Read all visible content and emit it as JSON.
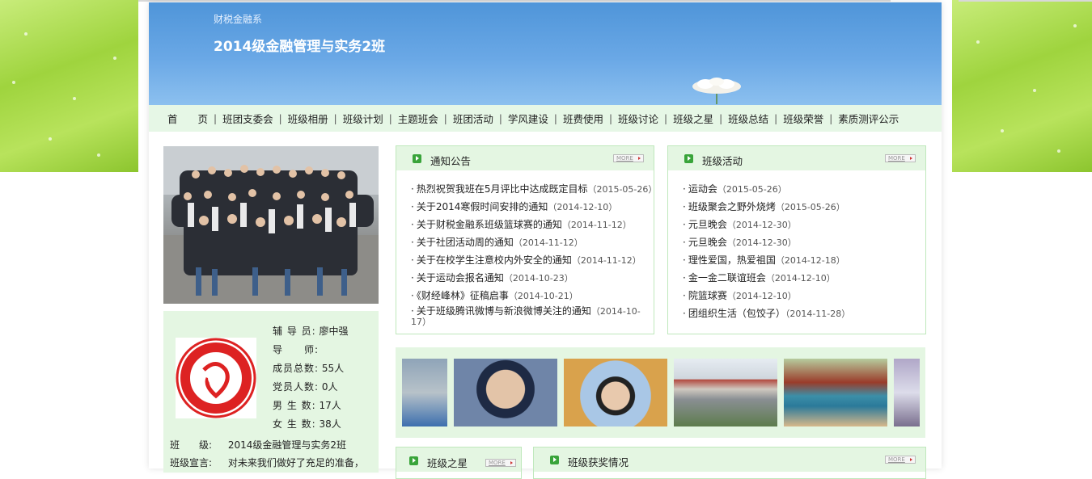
{
  "header": {
    "department": "财税金融系",
    "class_name": "2014级金融管理与实务2班"
  },
  "nav": {
    "items": [
      {
        "label": "首　　页"
      },
      {
        "label": "班团支委会"
      },
      {
        "label": "班级相册"
      },
      {
        "label": "班级计划"
      },
      {
        "label": "主题班会"
      },
      {
        "label": "班团活动"
      },
      {
        "label": "学风建设"
      },
      {
        "label": "班费使用"
      },
      {
        "label": "班级讨论"
      },
      {
        "label": "班级之星"
      },
      {
        "label": "班级总结"
      },
      {
        "label": "班级荣誉"
      },
      {
        "label": "素质测评公示"
      }
    ],
    "separator": "|"
  },
  "profile": {
    "counselor_label": "辅 导 员:",
    "counselor_value": "廖中强",
    "tutor_label": "导　　师:",
    "tutor_value": "",
    "members_label": "成员总数:",
    "members_value": "55人",
    "party_label": "党员人数:",
    "party_value": "0人",
    "male_label": "男 生 数:",
    "male_value": "17人",
    "female_label": "女 生 数:",
    "female_value": "38人",
    "class_label": "班　　级:",
    "class_value": "2014级金融管理与实务2班",
    "motto_label": "班级宣言:",
    "motto_value": "对未来我们做好了充足的准备，"
  },
  "notices": {
    "title": "通知公告",
    "more": "MORE",
    "items": [
      {
        "text": "热烈祝贺我班在5月评比中达成既定目标",
        "date": "（2015-05-26）"
      },
      {
        "text": "关于2014寒假时间安排的通知",
        "date": "（2014-12-10）"
      },
      {
        "text": "关于财税金融系班级篮球赛的通知",
        "date": "（2014-11-12）"
      },
      {
        "text": "关于社团活动周的通知",
        "date": "（2014-11-12）"
      },
      {
        "text": "关于在校学生注意校内外安全的通知",
        "date": "（2014-11-12）"
      },
      {
        "text": "关于运动会报名通知",
        "date": "（2014-10-23）"
      },
      {
        "text": "《财经峰林》征稿启事",
        "date": "（2014-10-21）"
      },
      {
        "text": "关于班级腾讯微博与新浪微博关注的通知",
        "date": "（2014-10-17）"
      }
    ]
  },
  "activities": {
    "title": "班级活动",
    "more": "MORE",
    "items": [
      {
        "text": "运动会",
        "date": "（2015-05-26）"
      },
      {
        "text": "班级聚会之野外烧烤",
        "date": "（2015-05-26）"
      },
      {
        "text": "元旦晚会",
        "date": "（2014-12-30）"
      },
      {
        "text": "元旦晚会",
        "date": "（2014-12-30）"
      },
      {
        "text": "理性爱国，热爱祖国",
        "date": "（2014-12-18）"
      },
      {
        "text": "金一金二联谊班会",
        "date": "（2014-12-10）"
      },
      {
        "text": "院篮球赛",
        "date": "（2014-12-10）"
      },
      {
        "text": "团组织生活（包饺子）",
        "date": "（2014-11-28）"
      }
    ]
  },
  "stars": {
    "title": "班级之星",
    "more": "MORE"
  },
  "awards": {
    "title": "班级获奖情况",
    "more": "MORE"
  }
}
